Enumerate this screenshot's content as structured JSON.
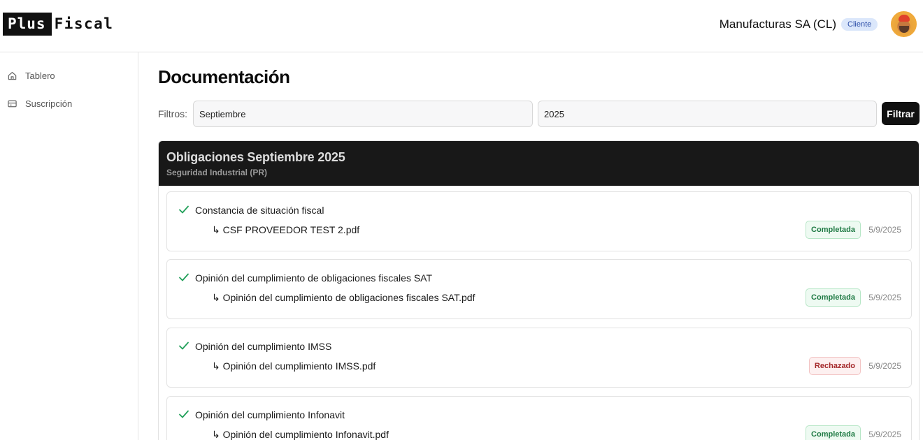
{
  "brand": {
    "part1": "Plus",
    "part2": "Fiscal"
  },
  "header": {
    "company": "Manufacturas SA (CL)",
    "role": "Cliente"
  },
  "sidebar": {
    "items": [
      {
        "label": "Tablero",
        "icon": "home-icon"
      },
      {
        "label": "Suscripción",
        "icon": "card-icon"
      }
    ]
  },
  "main": {
    "title": "Documentación",
    "filters": {
      "label": "Filtros:",
      "month": "Septiembre",
      "year": "2025",
      "button": "Filtrar"
    },
    "panel": {
      "title": "Obligaciones Septiembre 2025",
      "subtitle": "Seguridad Industrial (PR)",
      "items": [
        {
          "title": "Constancia de situación fiscal",
          "file": "↳ CSF PROVEEDOR TEST 2.pdf",
          "status": "Completada",
          "date": "5/9/2025"
        },
        {
          "title": "Opinión del cumplimiento de obligaciones fiscales SAT",
          "file": "↳ Opinión del cumplimiento de obligaciones fiscales SAT.pdf",
          "status": "Completada",
          "date": "5/9/2025"
        },
        {
          "title": "Opinión del cumplimiento IMSS",
          "file": "↳ Opinión del cumplimiento IMSS.pdf",
          "status": "Rechazado",
          "date": "5/9/2025"
        },
        {
          "title": "Opinión del cumplimiento Infonavit",
          "file": "↳ Opinión del cumplimiento Infonavit.pdf",
          "status": "Completada",
          "date": "5/9/2025"
        }
      ]
    }
  },
  "colors": {
    "accent": "#111111",
    "success": "#1f7a44",
    "danger": "#a4282a",
    "check": "#22a05a",
    "badge": "#dbe7fb"
  }
}
